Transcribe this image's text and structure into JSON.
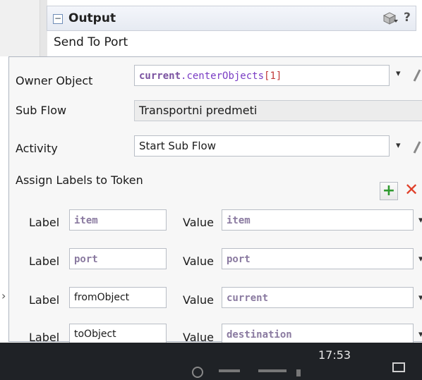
{
  "output_header": {
    "title": "Output",
    "collapse_symbol": "−",
    "help_symbol": "?"
  },
  "trigger": {
    "label": "Send To Port"
  },
  "owner_object": {
    "label": "Owner Object",
    "value_prefix": "current",
    "value_dot": ".",
    "value_method": "centerObjects",
    "value_open": "[",
    "value_index": "1",
    "value_close": "]"
  },
  "sub_flow": {
    "label": "Sub Flow",
    "value": "Transportni predmeti"
  },
  "activity": {
    "label": "Activity",
    "value": "Start Sub Flow"
  },
  "assign_labels": {
    "label": "Assign Labels to Token",
    "add_symbol": "+",
    "delete_symbol": "✕"
  },
  "label_rows": [
    {
      "label_caption": "Label",
      "label_value": "item",
      "value_caption": "Value",
      "value_value": "item"
    },
    {
      "label_caption": "Label",
      "label_value": "port",
      "value_caption": "Value",
      "value_value": "port"
    },
    {
      "label_caption": "Label",
      "label_value": "fromObject",
      "value_caption": "Value",
      "value_value": "current"
    },
    {
      "label_caption": "Label",
      "label_value": "toObject",
      "value_caption": "Value",
      "value_value": "destination"
    }
  ],
  "dropdown_arrow": "▾",
  "taskbar": {
    "time": "17:53"
  },
  "colors": {
    "accent_green": "#2f9a2f",
    "delete_red": "#e0402a",
    "code_purple": "#7a3dc4",
    "taskbar": "#1f2226"
  }
}
